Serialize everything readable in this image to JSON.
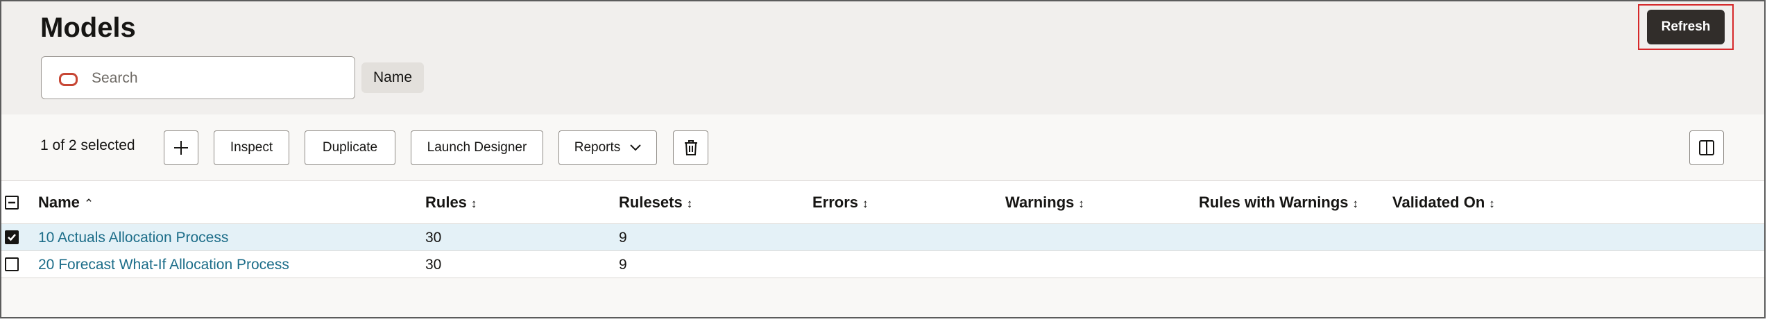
{
  "page": {
    "title": "Models"
  },
  "header": {
    "refresh_label": "Refresh"
  },
  "search": {
    "placeholder": "Search",
    "value": "",
    "filter_chip": "Name"
  },
  "toolbar": {
    "selection_text": "1 of 2 selected",
    "buttons": {
      "add": "+",
      "inspect": "Inspect",
      "duplicate": "Duplicate",
      "launch_designer": "Launch Designer",
      "reports": "Reports"
    },
    "icons": {
      "add": "plus-icon",
      "reports": "chevron-down-icon",
      "delete": "trash-icon",
      "panel": "split-panel-icon"
    }
  },
  "table": {
    "columns": [
      {
        "label": "Name",
        "sort": "⌃"
      },
      {
        "label": "Rules",
        "sort": "↕"
      },
      {
        "label": "Rulesets",
        "sort": "↕"
      },
      {
        "label": "Errors",
        "sort": "↕"
      },
      {
        "label": "Warnings",
        "sort": "↕"
      },
      {
        "label": "Rules with Warnings",
        "sort": "↕"
      },
      {
        "label": "Validated On",
        "sort": "↕"
      }
    ],
    "rows": [
      {
        "name": "10 Actuals Allocation Process",
        "rules": "30",
        "rulesets": "9",
        "errors": "",
        "warnings": "",
        "rules_with_warnings": "",
        "validated_on": "",
        "selected": true
      },
      {
        "name": "20 Forecast What-If Allocation Process",
        "rules": "30",
        "rulesets": "9",
        "errors": "",
        "warnings": "",
        "rules_with_warnings": "",
        "validated_on": "",
        "selected": false
      }
    ]
  },
  "colors": {
    "accent": "#312d2a",
    "highlight": "#d6282a",
    "link": "#1c6d89",
    "selected_row": "#e4f1f7",
    "search_icon": "#c74634"
  }
}
